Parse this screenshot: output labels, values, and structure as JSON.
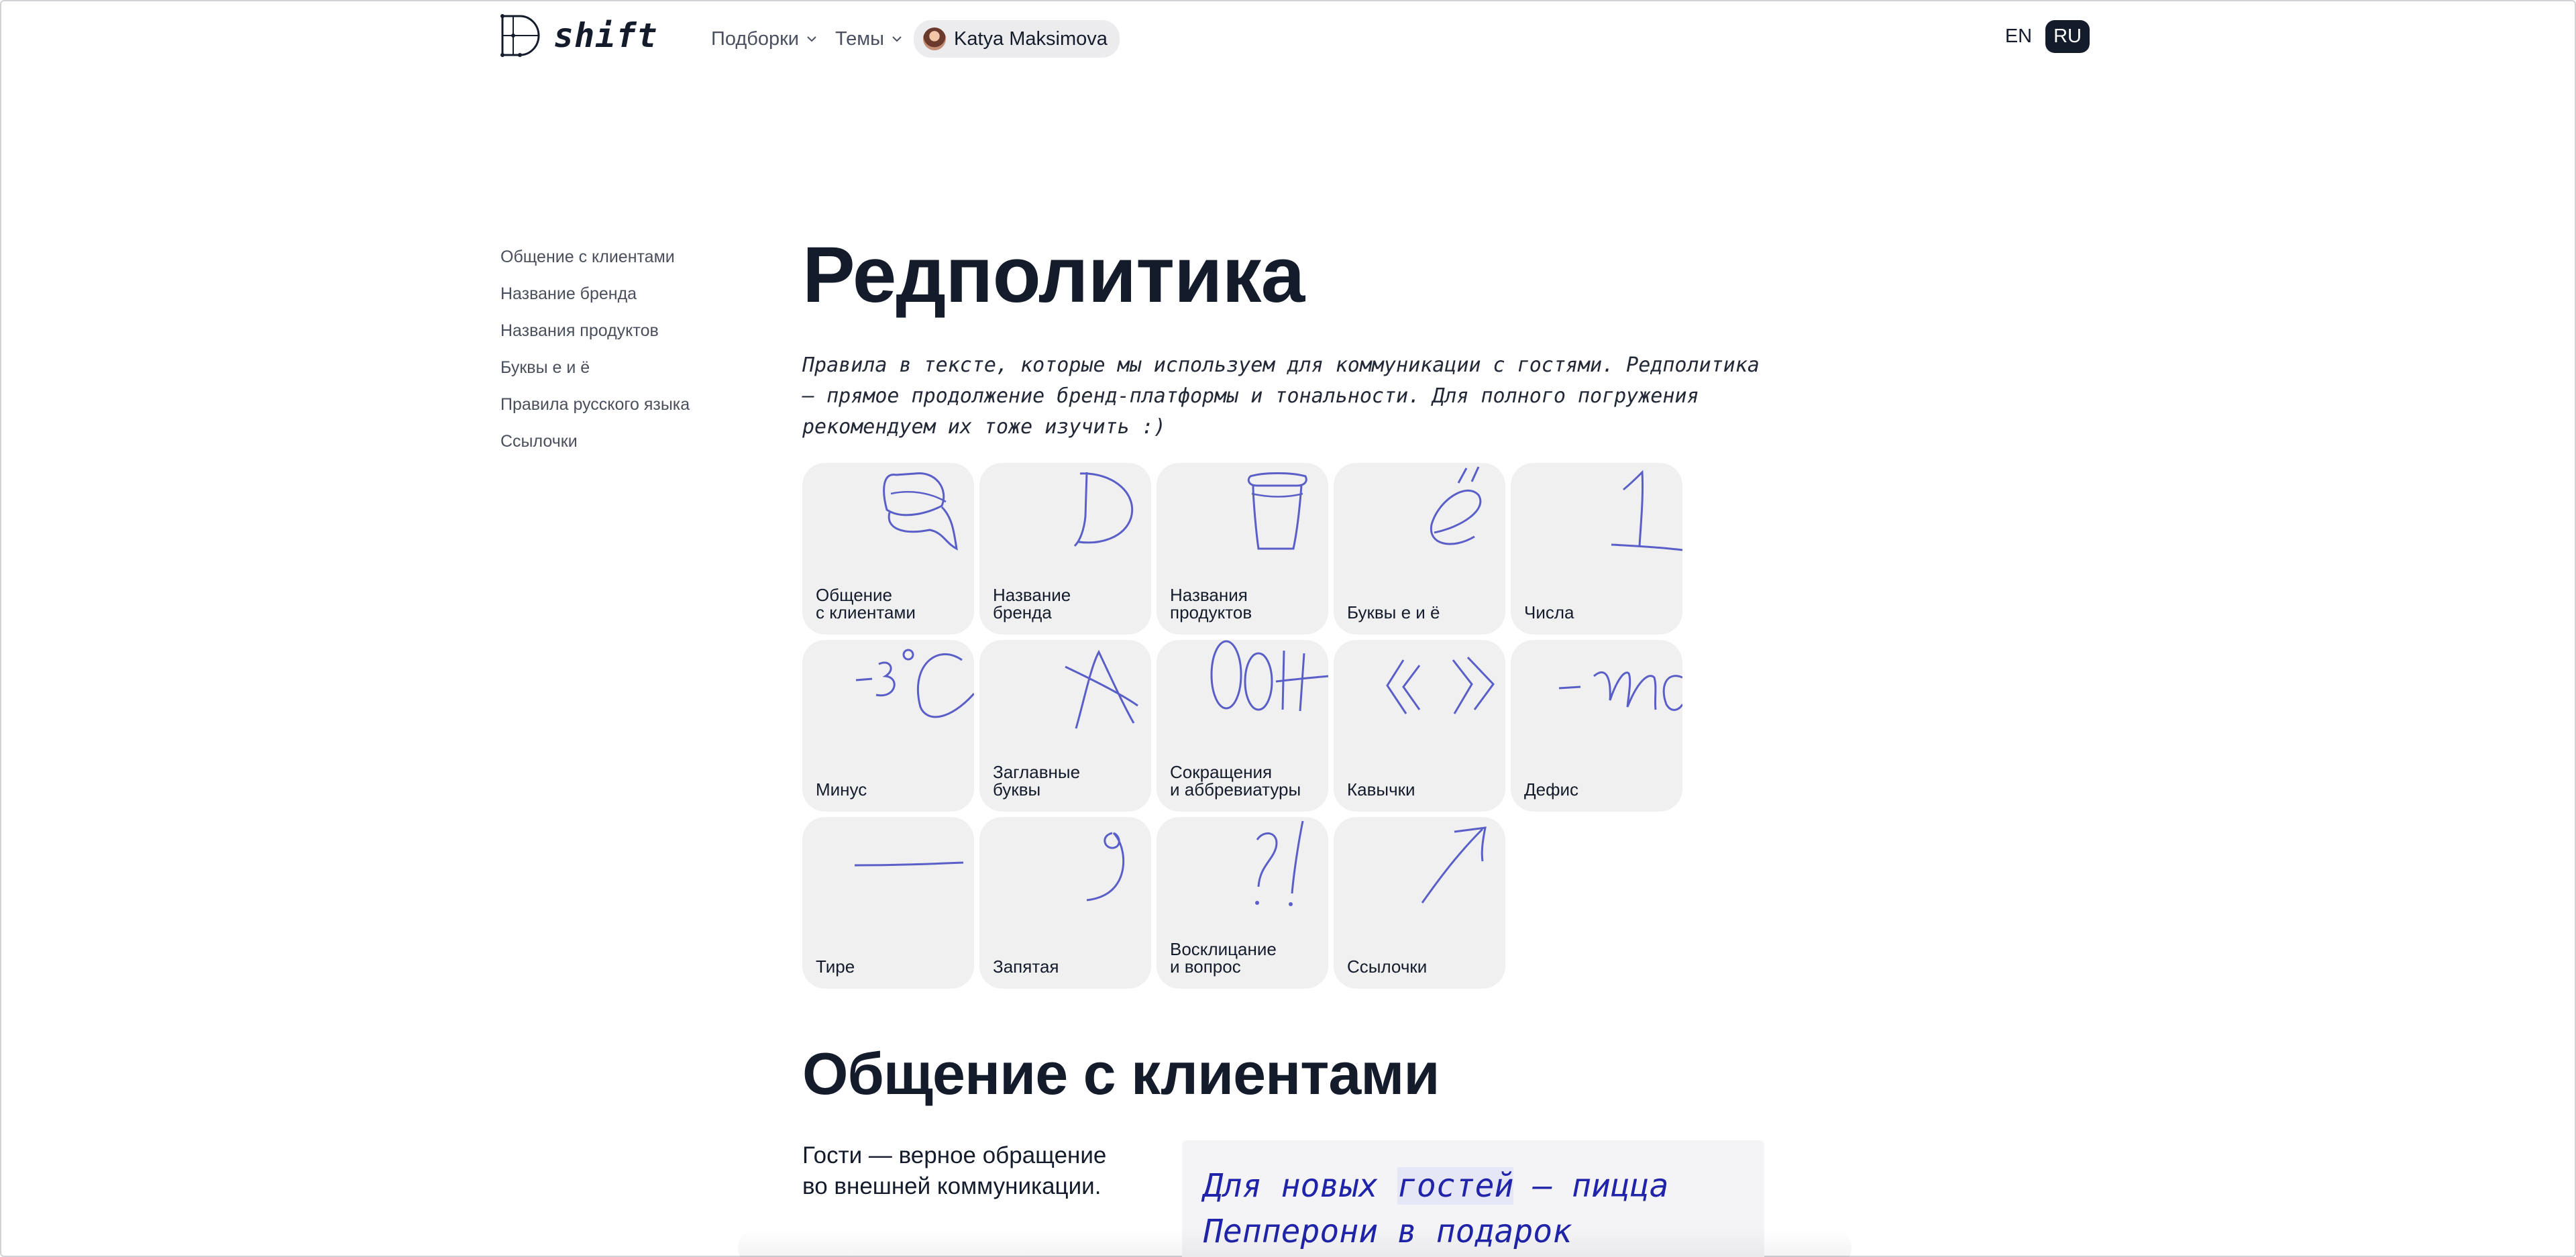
{
  "header": {
    "logo_text": "shift",
    "nav": [
      {
        "label": "Подборки"
      },
      {
        "label": "Темы"
      }
    ],
    "user": {
      "name": "Katya Maksimova"
    },
    "lang": [
      {
        "label": "EN",
        "active": false
      },
      {
        "label": "RU",
        "active": true
      }
    ]
  },
  "sidebar": {
    "items": [
      {
        "label": "Общение с клиентами"
      },
      {
        "label": "Название бренда"
      },
      {
        "label": "Названия продуктов"
      },
      {
        "label": "Буквы е и ё"
      },
      {
        "label": "Правила русского языка"
      },
      {
        "label": "Ссылочки"
      }
    ]
  },
  "main": {
    "title": "Редполитика",
    "intro": "Правила в тексте, которые мы используем для коммуникации с гостями. Редполитика — прямое продолжение бренд-платформы и тональности. Для полного погружения рекомендуем их тоже изучить :)",
    "cards": [
      {
        "label": "Общение\nс клиентами",
        "icon": "speech-bubbles-doodle"
      },
      {
        "label": "Название\nбренда",
        "icon": "letter-d-doodle"
      },
      {
        "label": "Названия\nпродуктов",
        "icon": "coffee-cup-doodle"
      },
      {
        "label": "Буквы е и ё",
        "icon": "letter-yo-doodle"
      },
      {
        "label": "Числа",
        "icon": "number-one-doodle"
      },
      {
        "label": "Минус",
        "icon": "minus-degrees-doodle",
        "doodle_text": "-3°C"
      },
      {
        "label": "Заглавные\nбуквы",
        "icon": "letter-a-doodle"
      },
      {
        "label": "Сокращения\nи аббревиатуры",
        "icon": "abbreviation-doodle",
        "doodle_text": "ООН"
      },
      {
        "label": "Кавычки",
        "icon": "quotes-doodle"
      },
      {
        "label": "Дефис",
        "icon": "hyphen-doodle",
        "doodle_text": "-то"
      },
      {
        "label": "Тире",
        "icon": "dash-doodle"
      },
      {
        "label": "Запятая",
        "icon": "comma-doodle"
      },
      {
        "label": "Восклицание\nи вопрос",
        "icon": "exclamation-question-doodle"
      },
      {
        "label": "Ссылочки",
        "icon": "arrow-doodle"
      }
    ],
    "section": {
      "title": "Общение с клиентами",
      "text": "Гости — верное обращение\nво внешней коммуникации.",
      "example_before": "Для новых ",
      "example_highlight": "гостей",
      "example_after": " — пицца\nПепперони в подарок"
    }
  },
  "colors": {
    "ink": "#141c2c",
    "card_bg": "#f0f0f1",
    "doodle_stroke": "#5a5fc7",
    "example_text": "#1f24a8"
  }
}
